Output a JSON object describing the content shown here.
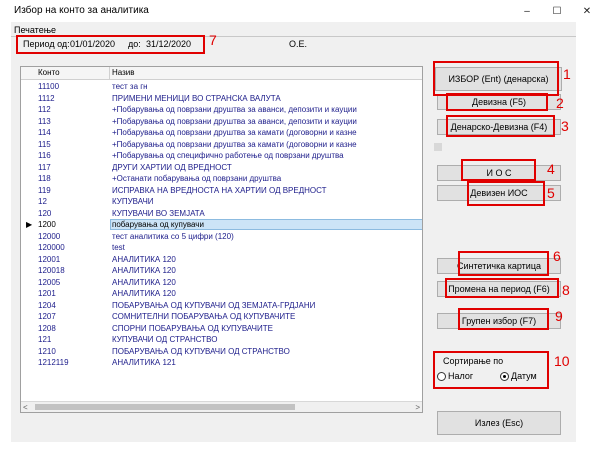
{
  "window": {
    "title": "Избор на конто за аналитика",
    "controls": [
      "–",
      "☐",
      "✕"
    ]
  },
  "menu": {
    "print": "Печатење"
  },
  "period": {
    "label": "Период од:",
    "from": "01/01/2020",
    "to_label": "до:",
    "to": "31/12/2020",
    "company": "О.Е."
  },
  "grid": {
    "columns": [
      "Конто",
      "Назив"
    ],
    "rows": [
      {
        "konto": "11100",
        "naziv": "тест за гн"
      },
      {
        "konto": "1112",
        "naziv": "ПРИМЕНИ МЕНИЦИ ВО СТРАНСКА ВАЛУТА"
      },
      {
        "konto": "112",
        "naziv": "+Побарувања од поврзани друштва за аванси, депозити и кауции"
      },
      {
        "konto": "113",
        "naziv": "+Побарувања од поврзани друштва за аванси, депозити и кауции"
      },
      {
        "konto": "114",
        "naziv": "+Побарувања од поврзани друштва за камати (договорни и казне"
      },
      {
        "konto": "115",
        "naziv": "+Побарувања од поврзани друштва за камати (договорни и казне"
      },
      {
        "konto": "116",
        "naziv": "+Побарувања од специфично работење од поврзани друштва"
      },
      {
        "konto": "117",
        "naziv": "ДРУГИ ХАРТИИ ОД ВРЕДНОСТ"
      },
      {
        "konto": "118",
        "naziv": "+Останати побарувања од поврзани друштва"
      },
      {
        "konto": "119",
        "naziv": "ИСПРАВКА НА ВРЕДНОСТА НА ХАРТИИ ОД ВРЕДНОСТ"
      },
      {
        "konto": "12",
        "naziv": "КУПУВАЧИ"
      },
      {
        "konto": "120",
        "naziv": "КУПУВАЧИ ВО ЗЕМЈАТА"
      },
      {
        "konto": "1200",
        "naziv": "побарувања од купувачи",
        "selected": true
      },
      {
        "konto": "12000",
        "naziv": "тест аналитика со 5 цифри (120)"
      },
      {
        "konto": "120000",
        "naziv": "test"
      },
      {
        "konto": "12001",
        "naziv": "АНАЛИТИКА 120"
      },
      {
        "konto": "120018",
        "naziv": "АНАЛИТИКА 120"
      },
      {
        "konto": "12005",
        "naziv": "АНАЛИТИКА 120"
      },
      {
        "konto": "1201",
        "naziv": "АНАЛИТИКА 120"
      },
      {
        "konto": "1204",
        "naziv": "ПОБАРУВАЊА ОД КУПУВАЧИ ОД ЗЕМЈАТА-ГРДЈАНИ"
      },
      {
        "konto": "1207",
        "naziv": "СОМНИТЕЛНИ ПОБАРУВАЊА ОД КУПУВАЧИТЕ"
      },
      {
        "konto": "1208",
        "naziv": "СПОРНИ ПОБАРУВАЊА ОД КУПУВАЧИТЕ"
      },
      {
        "konto": "121",
        "naziv": "КУПУВАЧИ ОД СТРАНСТВО"
      },
      {
        "konto": "1210",
        "naziv": "ПОБАРУВАЊА ОД КУПУВАЧИ ОД СТРАНСТВО"
      },
      {
        "konto": "1212119",
        "naziv": "АНАЛИТИКА 121"
      }
    ],
    "pointer": "▶",
    "scroll_left": "<",
    "scroll_right": ">"
  },
  "buttons": {
    "izbor": "ИЗБОР (Ent) (денарска)",
    "devizna": "Девизна (F5)",
    "denarsko_devizna": "Денарско-Девизна (F4)",
    "ios": "И О С",
    "devizen_ios": "Девизен ИОС",
    "sintetichka": "Синтетичка картица",
    "promena": "Промена на период (F6)",
    "grupen": "Групен избор (F7)",
    "izlez": "Излез (Esc)"
  },
  "sort": {
    "label": "Сортирање по",
    "options": [
      {
        "label": "Налог",
        "checked": false
      },
      {
        "label": "Датум",
        "checked": true
      }
    ]
  },
  "annotations": [
    "1",
    "2",
    "3",
    "4",
    "5",
    "6",
    "7",
    "8",
    "9",
    "10"
  ],
  "colors": {
    "annotation": "#e00000",
    "selection": "#cce4f7",
    "row_text": "#1c1c8a"
  }
}
